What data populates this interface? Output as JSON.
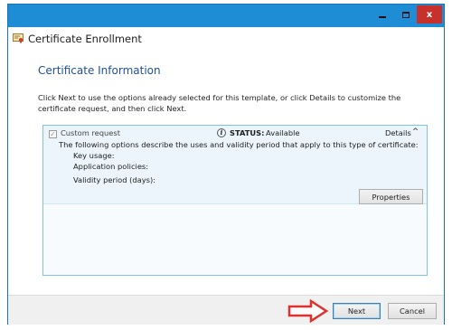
{
  "window": {
    "title": "Certificate Enrollment",
    "controls": {
      "minimize": "minimize",
      "maximize": "maximize",
      "close": "x"
    },
    "accent_color": "#1f8dd6",
    "close_color": "#c7312b"
  },
  "page": {
    "section_title": "Certificate Information",
    "instructions": "Click Next to use the options already selected for this template, or click Details to customize the certificate request, and then click Next."
  },
  "certificate_item": {
    "checkbox_checked": true,
    "checkbox_mark": "✓",
    "name": "Custom request",
    "status_icon": "i",
    "status_label": "STATUS:",
    "status_value": "Available",
    "details_label": "Details",
    "details_chevron": "^",
    "description": "The following options describe the uses and validity period that apply to this type of certificate:",
    "properties": [
      "Key usage:",
      "Application policies:",
      "Validity period (days):"
    ],
    "properties_button": "Properties"
  },
  "footer": {
    "next_button": "Next",
    "cancel_button": "Cancel",
    "annotation_arrow_color": "#e0312c"
  }
}
